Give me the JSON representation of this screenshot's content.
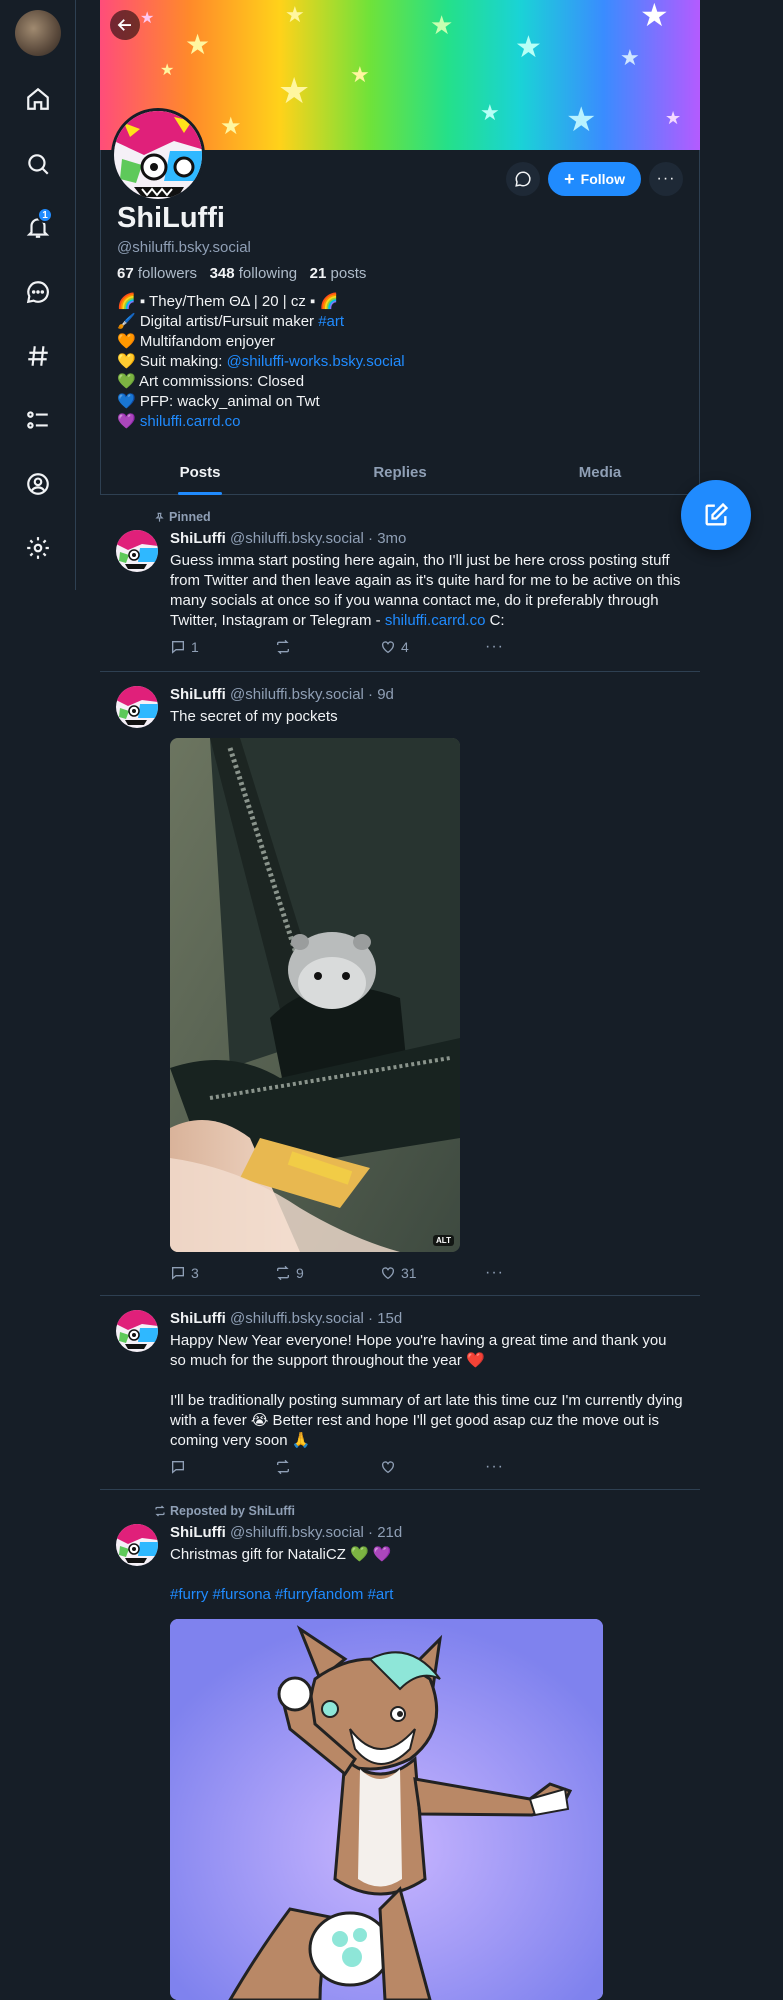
{
  "nav": {
    "notif_count": "1"
  },
  "profile": {
    "display_name": "ShiLuffi",
    "handle": "@shiluffi.bsky.social",
    "followers_count": "67",
    "followers_label": "followers",
    "following_count": "348",
    "following_label": "following",
    "posts_count": "21",
    "posts_label": "posts",
    "follow_label": "Follow",
    "bio": {
      "line1": "🌈 ▪ They/Them ΘΔ | 20 | cz ▪ 🌈",
      "line2_text": "🖌️ Digital artist/Fursuit maker ",
      "line2_tag": "#art",
      "line3": "🧡 Multifandom enjoyer",
      "line4_text": "💛 Suit making: ",
      "line4_link": "@shiluffi-works.bsky.social",
      "line5": "💚 Art commissions: Closed",
      "line6": "💙 PFP: wacky_animal on Twt",
      "line7_emoji": "💜 ",
      "line7_link": "shiluffi.carrd.co"
    }
  },
  "tabs": [
    "Posts",
    "Replies",
    "Media"
  ],
  "posts": [
    {
      "context": "Pinned",
      "author": "ShiLuffi",
      "meta": "@shiluffi.bsky.social · 3mo",
      "text": "Guess imma start posting here again, tho I'll just be here cross posting stuff from Twitter and then leave again as it's quite hard for me to be active on this many socials at once so if you wanna contact me, do it preferably through Twitter, Instagram or Telegram - ",
      "link": "shiluffi.carrd.co",
      "text_after": " C:",
      "replies": "1",
      "reposts": "",
      "likes": "4"
    },
    {
      "author": "ShiLuffi",
      "meta": "@shiluffi.bsky.social · 9d",
      "text": "The secret of my pockets",
      "alt": "ALT",
      "replies": "3",
      "reposts": "9",
      "likes": "31"
    },
    {
      "author": "ShiLuffi",
      "meta": "@shiluffi.bsky.social · 15d",
      "text1": "Happy New Year everyone! Hope you're having a great time and thank you so much for the support throughout the year ❤️",
      "text2": "I'll be traditionally posting summary of art late this time cuz I'm currently dying with a fever 😭 Better rest and hope I'll get good asap cuz the move out is coming very soon 🙏",
      "replies": "",
      "reposts": "",
      "likes": ""
    },
    {
      "context": "Reposted by ShiLuffi",
      "author": "ShiLuffi",
      "meta": "@shiluffi.bsky.social · 21d",
      "text": "Christmas gift for NataliCZ 💚 💜",
      "tags": "#furry #fursona #furryfandom #art"
    }
  ],
  "colors": {
    "background": "#161e27",
    "accent": "#208bfe",
    "muted": "#8f9fb5",
    "border": "#2e4052"
  }
}
